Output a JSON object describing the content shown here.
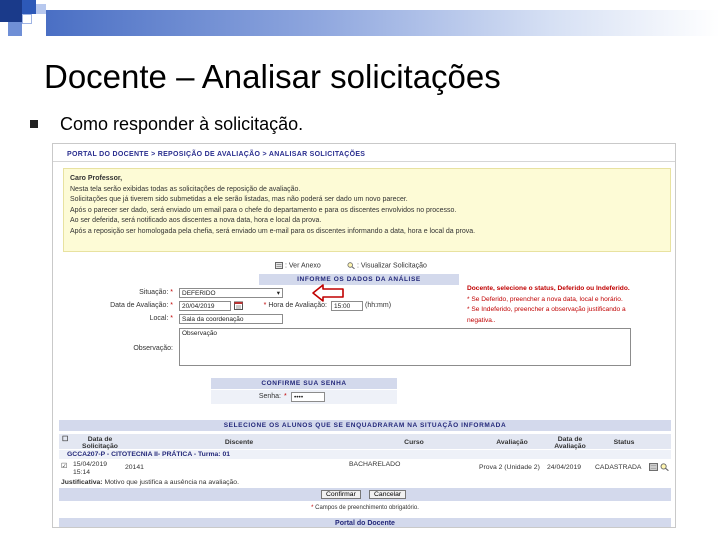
{
  "slide": {
    "title": "Docente – Analisar solicitações",
    "bullet": "Como responder à solicitação."
  },
  "breadcrumb": "PORTAL DO DOCENTE > REPOSIÇÃO DE AVALIAÇÃO > ANALISAR SOLICITAÇÕES",
  "notice": {
    "lines": [
      "Caro Professor,",
      "Nesta tela serão exibidas todas as solicitações de reposição de avaliação.",
      "Solicitações que já tiverem sido submetidas a ele serão listadas, mas não poderá ser dado um novo parecer.",
      "Após o parecer ser dado, será enviado um email para o chefe do departamento e para os discentes envolvidos no processo.",
      "Ao ser deferida, será notificado aos discentes a nova data, hora e local da prova.",
      "Após a reposição ser homologada pela chefia, será enviado um e-mail para os discentes informando a data, hora e local da prova."
    ]
  },
  "toolbar": {
    "ver_anexo": ": Ver Anexo",
    "visualizar": ": Visualizar Solicitação"
  },
  "form": {
    "section_title": "INFORME OS DADOS DA ANÁLISE",
    "situacao_label": "Situação:",
    "situacao_value": "DEFERIDO",
    "data_label": "Data de Avaliação:",
    "data_value": "20/04/2019",
    "hora_label": "Hora de Avaliação:",
    "hora_value": "15:00",
    "hora_hint": "(hh:mm)",
    "local_label": "Local:",
    "local_value": "Sala da coordenação",
    "obs_label": "Observação:",
    "obs_value": "Observação",
    "required_mark": "*"
  },
  "hint": {
    "lines": [
      "Docente, selecione o status, Deferido ou Indeferido.",
      "* Se Deferido, preencher a nova data, local e horário.",
      "* Se Indeferido, preencher a observação justificando a",
      "negativa.."
    ]
  },
  "password": {
    "section_title": "CONFIRME SUA SENHA",
    "label": "Senha:",
    "value": "••••",
    "required_mark": "*"
  },
  "list": {
    "section_title": "SELECIONE OS ALUNOS QUE SE ENQUADRARAM NA SITUAÇÃO INFORMADA",
    "columns": {
      "data_solicitacao": "Data de Solicitação",
      "discente": "Discente",
      "curso": "Curso",
      "avaliacao": "Avaliação",
      "data_avaliacao": "Data de Avaliação",
      "status": "Status"
    },
    "group": "GCCA207-P - CITOTECNIA II- PRÁTICA - Turma: 01",
    "row": {
      "date": "15/04/2019",
      "time": "15:14",
      "discente": "20141",
      "curso": "BACHARELADO",
      "avaliacao": "Prova 2 (Unidade 2)",
      "data_avaliacao": "24/04/2019",
      "status": "CADASTRADA"
    },
    "justificativa_label": "Justificativa:",
    "justificativa_value": "Motivo que justifica a ausência na avaliação."
  },
  "buttons": {
    "confirm": "Confirmar",
    "cancel": "Cancelar"
  },
  "required_note": "Campos de preenchimento obrigatório.",
  "footer": "Portal do Docente",
  "colors": {
    "link": "#23287a",
    "alert": "#c00000",
    "section_bg": "#d3d9ec",
    "notice_bg": "#fdfbd6"
  }
}
